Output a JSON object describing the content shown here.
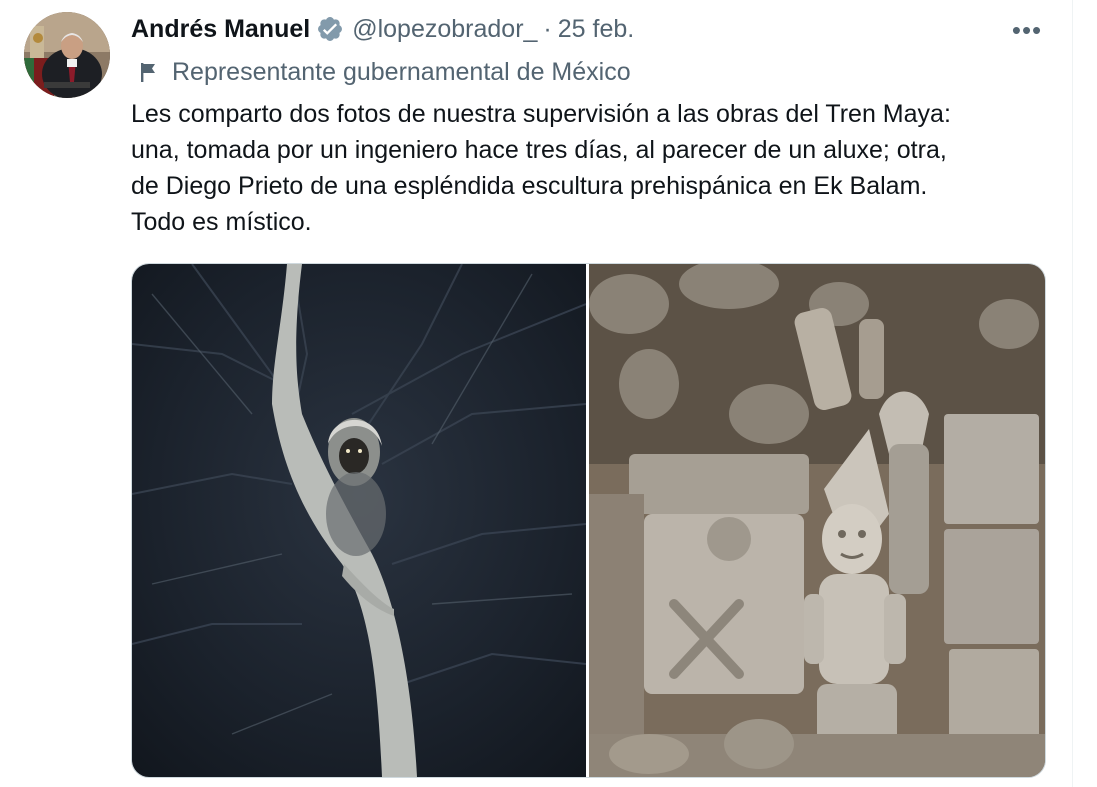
{
  "author": {
    "name": "Andrés Manuel",
    "handle": "@lopezobrador_",
    "separator": "·",
    "date": "25 feb.",
    "verified_icon": "verified-badge-icon",
    "verified_color": "#829aab"
  },
  "affiliation": {
    "icon": "flag-icon",
    "label": "Representante gubernamental de México"
  },
  "more_menu": {
    "icon": "more-icon",
    "label": "•••"
  },
  "tweet": {
    "lines": [
      "Les comparto dos fotos de nuestra supervisión a las obras del Tren Maya:",
      "una, tomada por un ingeniero hace tres días, al parecer de un aluxe; otra,",
      "de Diego Prieto de una espléndida escultura prehispánica en Ek Balam.",
      "Todo es místico."
    ]
  },
  "media": [
    {
      "kind": "photo",
      "subject": "night-tree-aluxe"
    },
    {
      "kind": "photo",
      "subject": "ek-balam-sculpture"
    }
  ],
  "colors": {
    "text_primary": "#0f1419",
    "text_secondary": "#536471",
    "border": "#cfd9de"
  }
}
